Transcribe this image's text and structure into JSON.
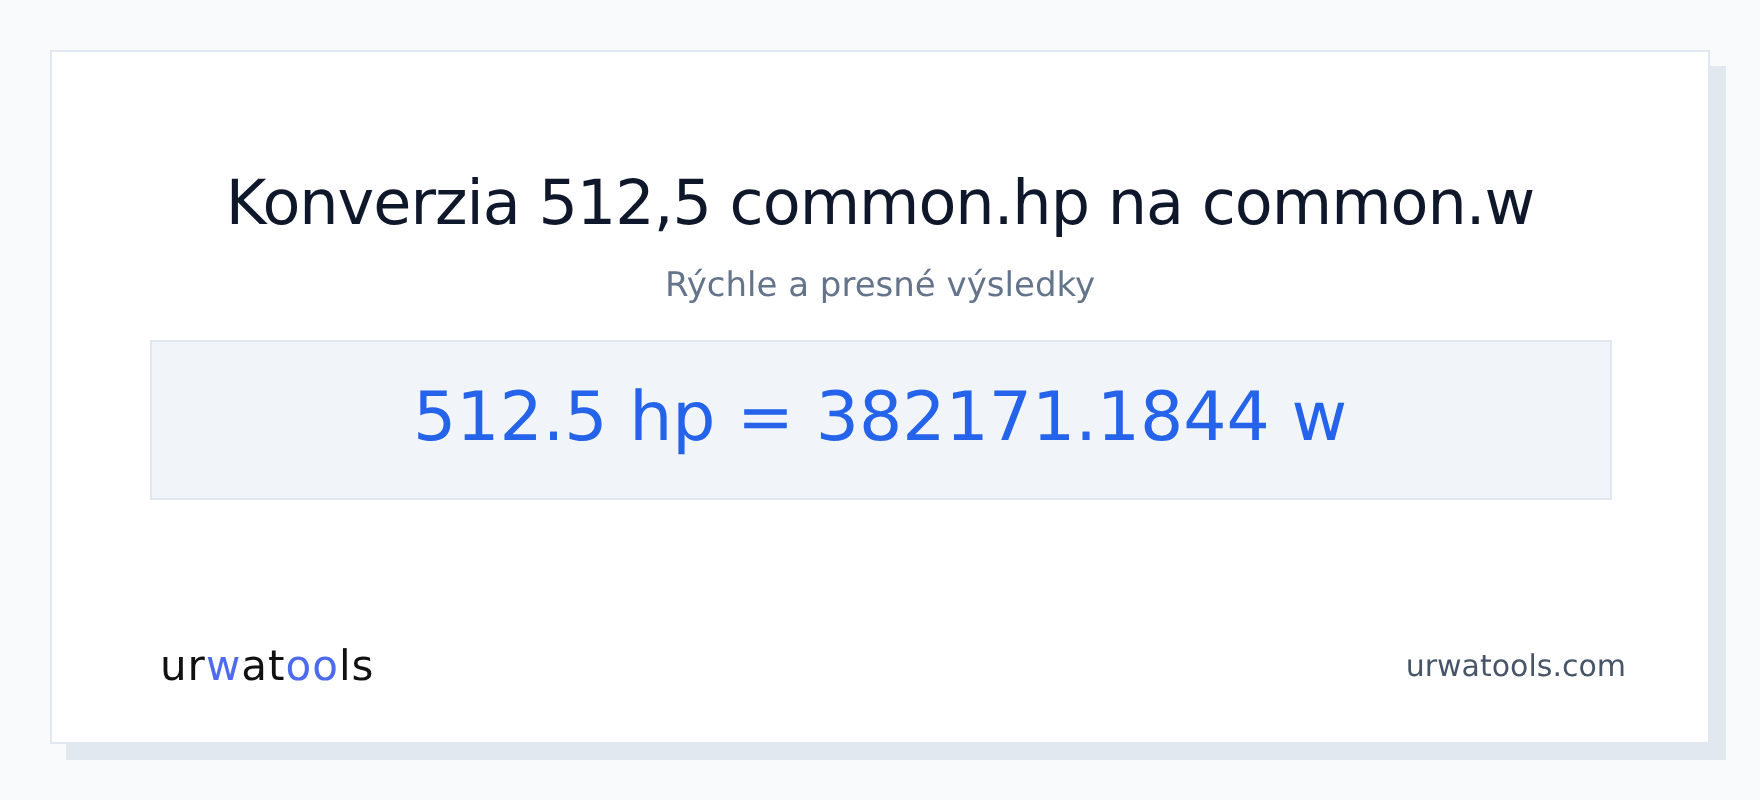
{
  "title": "Konverzia 512,5 common.hp na common.w",
  "subtitle": "Rýchle a presné výsledky",
  "result": "512.5 hp = 382171.1844 w",
  "logo": [
    {
      "text": "ur",
      "accent": false
    },
    {
      "text": "w",
      "accent": true
    },
    {
      "text": "at",
      "accent": false
    },
    {
      "text": "oo",
      "accent": true
    },
    {
      "text": "ls",
      "accent": false
    }
  ],
  "site": "urwatools.com"
}
